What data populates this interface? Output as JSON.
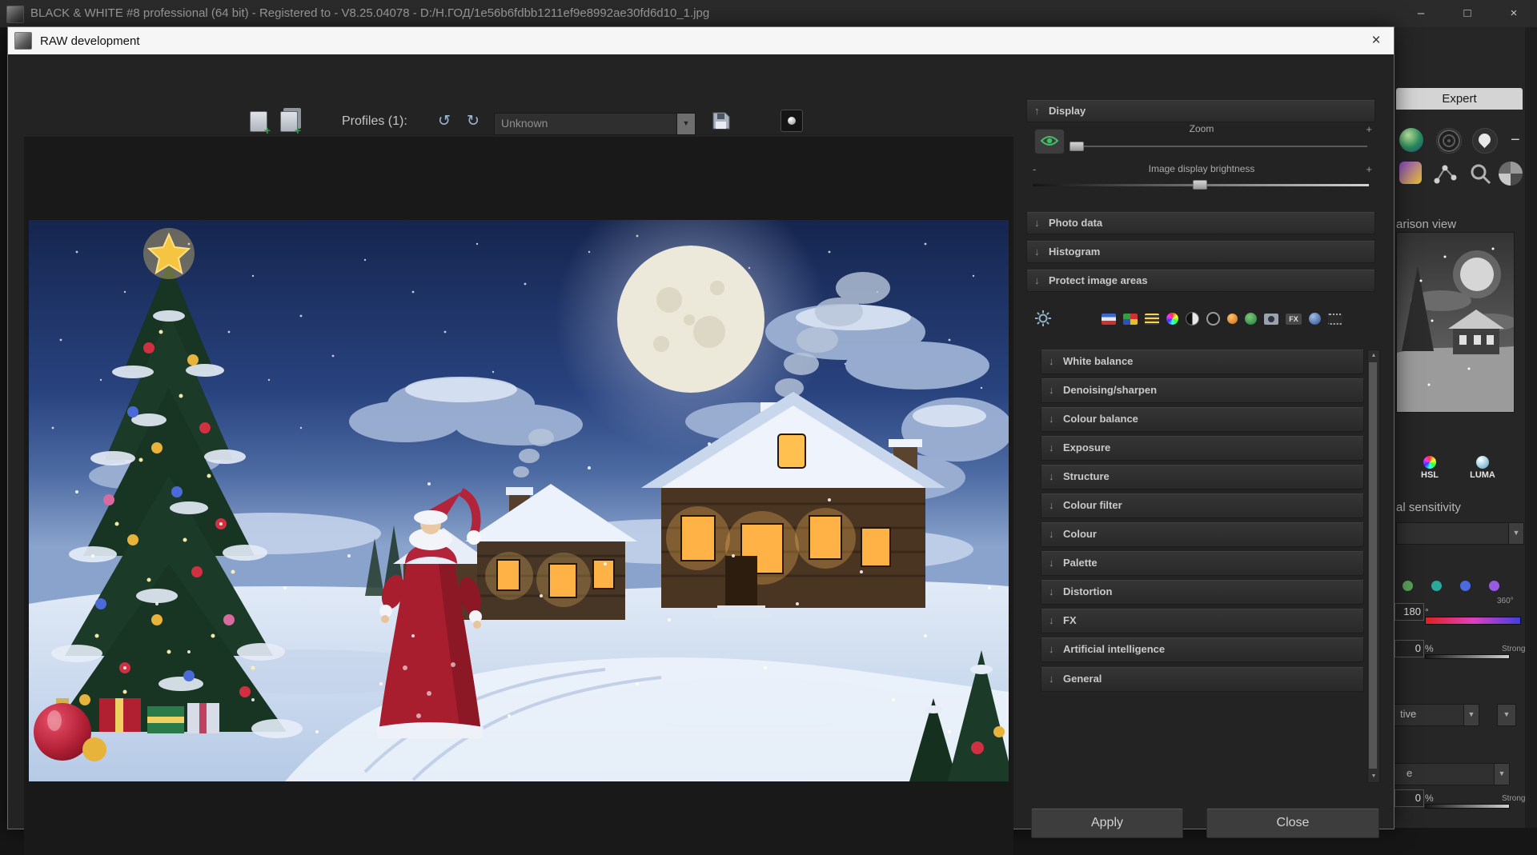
{
  "app": {
    "title": "BLACK & WHITE #8 professional (64 bit) - Registered to - V8.25.04078 - D:/Н.ГОД/1e56b6fdbb1211ef9e8992ae30fd6d10_1.jpg",
    "window": {
      "minimize": "–",
      "maximize": "□",
      "close": "×"
    }
  },
  "dialog": {
    "title": "RAW development",
    "close": "×",
    "toolbar": {
      "profiles_label": "Profiles (1):",
      "profile_value": "Unknown",
      "undo": "↺",
      "redo": "↻"
    },
    "display": {
      "title": "Display",
      "zoom_label": "Zoom",
      "brightness_label": "Image display brightness",
      "minus": "-",
      "plus": "+"
    },
    "arrows": {
      "up": "↑",
      "down": "↓"
    },
    "sections_top": [
      "Photo data",
      "Histogram",
      "Protect image areas"
    ],
    "sections": [
      "White balance",
      "Denoising/sharpen",
      "Colour balance",
      "Exposure",
      "Structure",
      "Colour filter",
      "Colour",
      "Palette",
      "Distortion",
      "FX",
      "Artificial intelligence",
      "General"
    ],
    "fx_icon_label": "FX",
    "apply": "Apply",
    "close_btn": "Close"
  },
  "side": {
    "expert_tab": "Expert",
    "minus": "−",
    "comparison": "arison view",
    "hsl": "HSL",
    "luma": "LUMA",
    "sensitivity": "al sensitivity",
    "hue": {
      "value": "180",
      "unit": "°",
      "max": "360°"
    },
    "strength1": {
      "value": "0",
      "unit": "%",
      "label": "Strong"
    },
    "dropdown1": "tive",
    "dropdown2": "e",
    "strength2": {
      "value": "0",
      "unit": "%",
      "label": "Strong"
    }
  },
  "icons": {
    "dropdown": "▼",
    "scroll_up": "▲",
    "scroll_down": "▼"
  }
}
